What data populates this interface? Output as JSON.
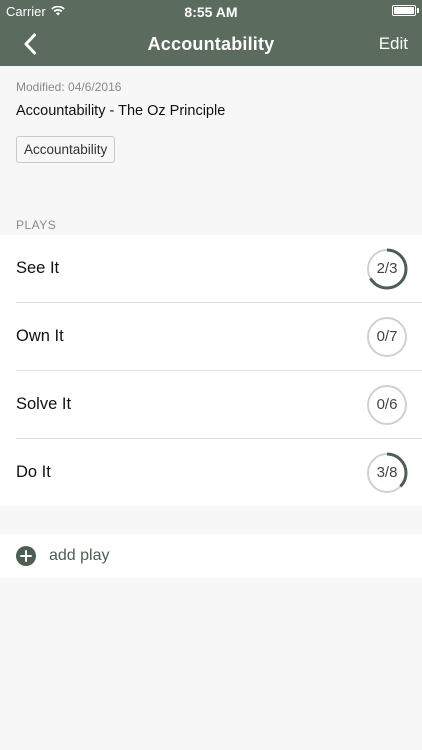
{
  "status_bar": {
    "carrier": "Carrier",
    "time": "8:55 AM"
  },
  "nav": {
    "title": "Accountability",
    "edit_label": "Edit"
  },
  "detail": {
    "modified": "Modified: 04/6/2016",
    "subtitle": "Accountability - The Oz Principle",
    "tag": "Accountability"
  },
  "plays_section": {
    "label": "PLAYS",
    "items": [
      {
        "name": "See It",
        "progress": "2/3",
        "done": 2,
        "total": 3
      },
      {
        "name": "Own It",
        "progress": "0/7",
        "done": 0,
        "total": 7
      },
      {
        "name": "Solve It",
        "progress": "0/6",
        "done": 0,
        "total": 6
      },
      {
        "name": "Do It",
        "progress": "3/8",
        "done": 3,
        "total": 8
      }
    ]
  },
  "add_play": {
    "label": "add play"
  },
  "colors": {
    "nav_bg": "#5b6b5e",
    "accent": "#4c5f50",
    "ring_track": "#d0d0d0"
  }
}
